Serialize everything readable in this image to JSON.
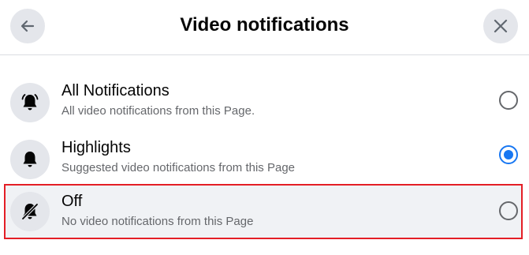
{
  "dialog": {
    "title": "Video notifications",
    "back_icon": "arrow-left-icon",
    "close_icon": "close-icon"
  },
  "options": [
    {
      "title": "All Notifications",
      "subtitle": "All video notifications from this Page.",
      "icon": "bell-ringing-icon",
      "selected": false
    },
    {
      "title": "Highlights",
      "subtitle": "Suggested video notifications from this Page",
      "icon": "bell-icon",
      "selected": true
    },
    {
      "title": "Off",
      "subtitle": "No video notifications from this Page",
      "icon": "bell-off-icon",
      "selected": false
    }
  ],
  "colors": {
    "accent": "#1877f2",
    "highlight_border": "#e41e26"
  }
}
